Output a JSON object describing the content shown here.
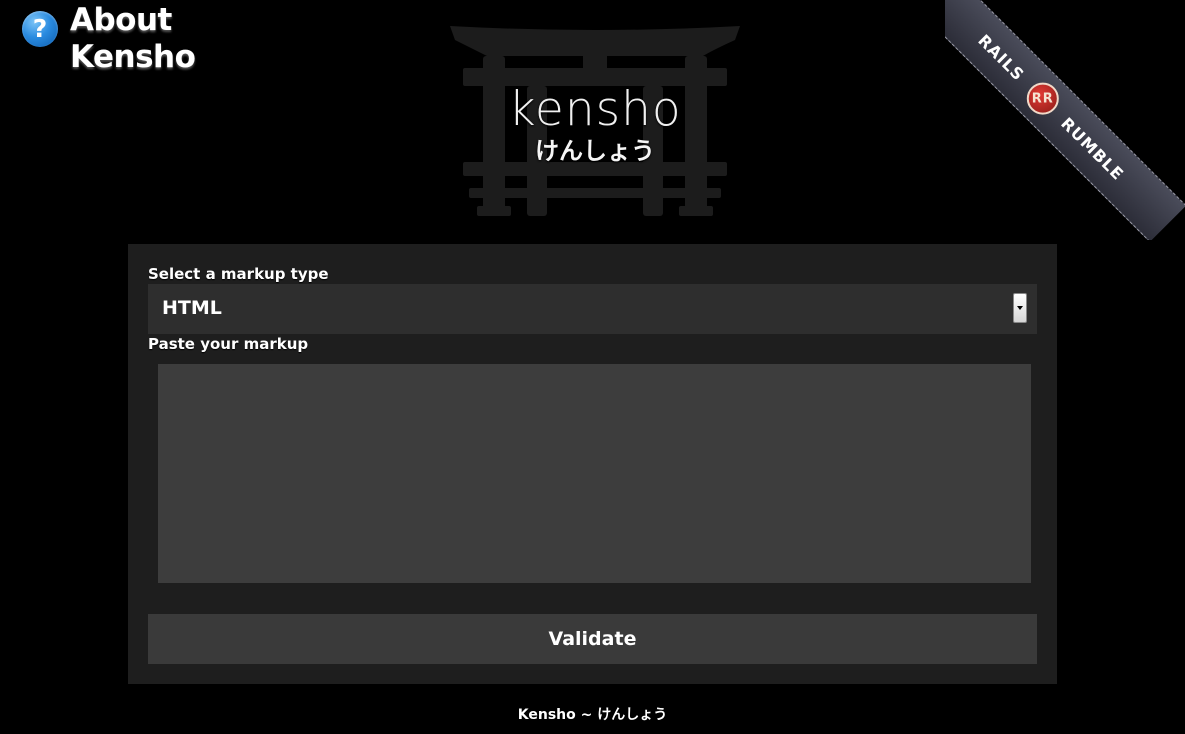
{
  "about": {
    "icon": "question-icon",
    "icon_glyph": "?",
    "label_line1": "About",
    "label_line2": "Kensho"
  },
  "logo": {
    "word": "kensho",
    "kana": "けんしょう",
    "image": "torii-gate"
  },
  "ribbon": {
    "left_text": "RAILS",
    "badge_text": "RR",
    "right_text": "RUMBLE"
  },
  "form": {
    "markup_label": "Select a markup type",
    "markup_selected": "HTML",
    "paste_label": "Paste your markup",
    "paste_value": "",
    "validate_label": "Validate"
  },
  "footer": {
    "text": "Kensho ~ けんしょう"
  },
  "colors": {
    "background": "#000000",
    "panel": "#1e1e1e",
    "field": "#2e2e2e",
    "textarea": "#3d3d3d",
    "button": "#3a3a3a",
    "about_icon": "#2a8be0"
  }
}
